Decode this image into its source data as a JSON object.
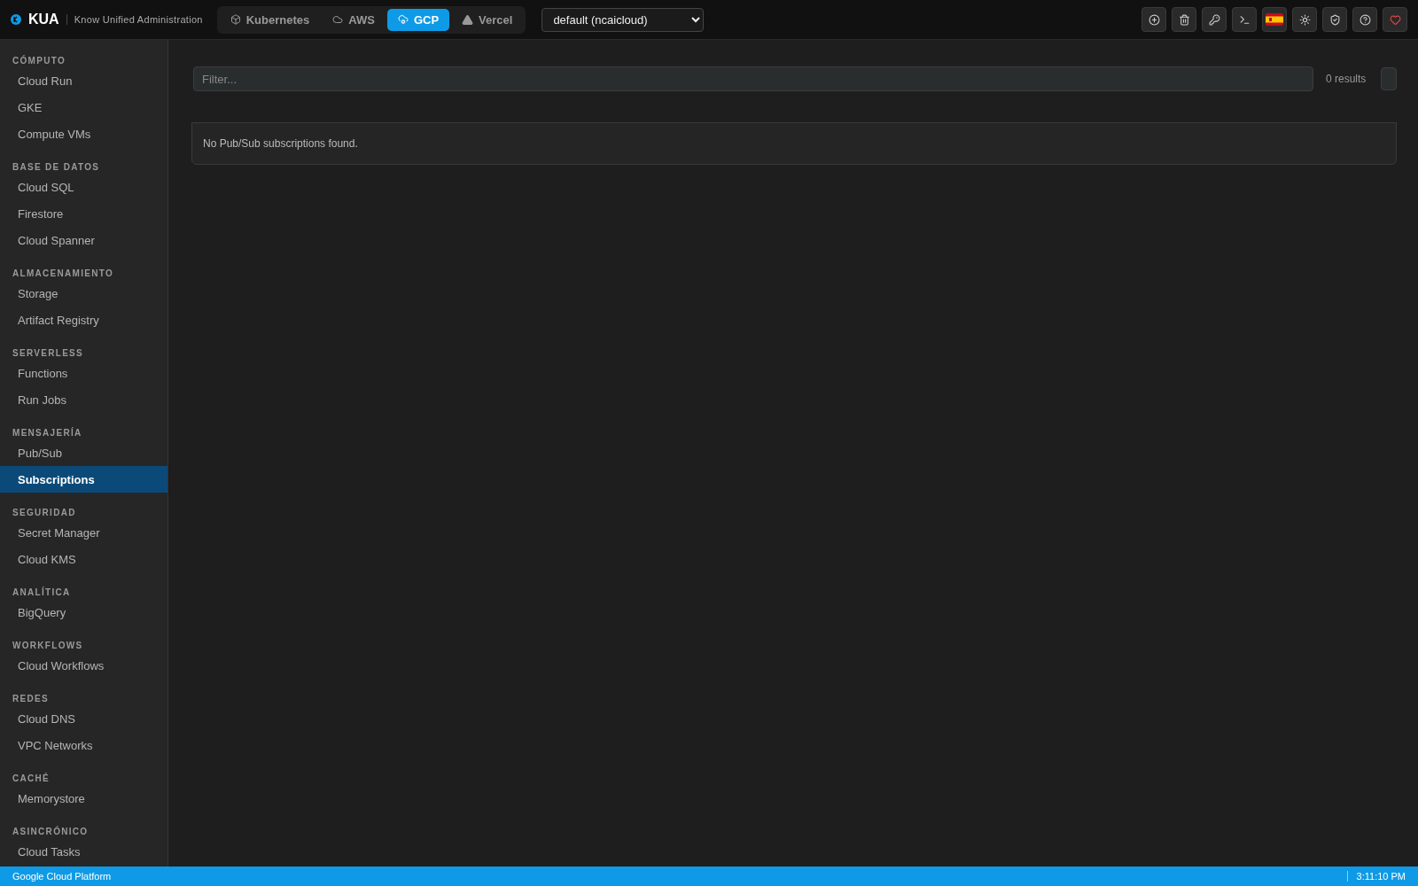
{
  "brand": {
    "name": "KUA",
    "tagline": "Know Unified Administration"
  },
  "providers": [
    {
      "label": "Kubernetes",
      "selected": false
    },
    {
      "label": "AWS",
      "selected": false
    },
    {
      "label": "GCP",
      "selected": true
    },
    {
      "label": "Vercel",
      "selected": false
    }
  ],
  "project_select": {
    "value": "default (ncaicloud)"
  },
  "sidebar": {
    "sections": [
      {
        "title": "CÓMPUTO",
        "items": [
          {
            "label": "Cloud Run",
            "selected": false
          },
          {
            "label": "GKE",
            "selected": false
          },
          {
            "label": "Compute VMs",
            "selected": false
          }
        ]
      },
      {
        "title": "BASE DE DATOS",
        "items": [
          {
            "label": "Cloud SQL",
            "selected": false
          },
          {
            "label": "Firestore",
            "selected": false
          },
          {
            "label": "Cloud Spanner",
            "selected": false
          }
        ]
      },
      {
        "title": "ALMACENAMIENTO",
        "items": [
          {
            "label": "Storage",
            "selected": false
          },
          {
            "label": "Artifact Registry",
            "selected": false
          }
        ]
      },
      {
        "title": "SERVERLESS",
        "items": [
          {
            "label": "Functions",
            "selected": false
          },
          {
            "label": "Run Jobs",
            "selected": false
          }
        ]
      },
      {
        "title": "MENSAJERÍA",
        "items": [
          {
            "label": "Pub/Sub",
            "selected": false
          },
          {
            "label": "Subscriptions",
            "selected": true
          }
        ]
      },
      {
        "title": "SEGURIDAD",
        "items": [
          {
            "label": "Secret Manager",
            "selected": false
          },
          {
            "label": "Cloud KMS",
            "selected": false
          }
        ]
      },
      {
        "title": "ANALÍTICA",
        "items": [
          {
            "label": "BigQuery",
            "selected": false
          }
        ]
      },
      {
        "title": "WORKFLOWS",
        "items": [
          {
            "label": "Cloud Workflows",
            "selected": false
          }
        ]
      },
      {
        "title": "REDES",
        "items": [
          {
            "label": "Cloud DNS",
            "selected": false
          },
          {
            "label": "VPC Networks",
            "selected": false
          }
        ]
      },
      {
        "title": "CACHÉ",
        "items": [
          {
            "label": "Memorystore",
            "selected": false
          }
        ]
      },
      {
        "title": "ASINCRÓNICO",
        "items": [
          {
            "label": "Cloud Tasks",
            "selected": false
          }
        ]
      }
    ]
  },
  "filter": {
    "placeholder": "Filter...",
    "results": "0 results"
  },
  "empty_message": "No Pub/Sub subscriptions found.",
  "status_bar": {
    "left": "Google Cloud Platform",
    "right": "3:11:10 PM"
  }
}
